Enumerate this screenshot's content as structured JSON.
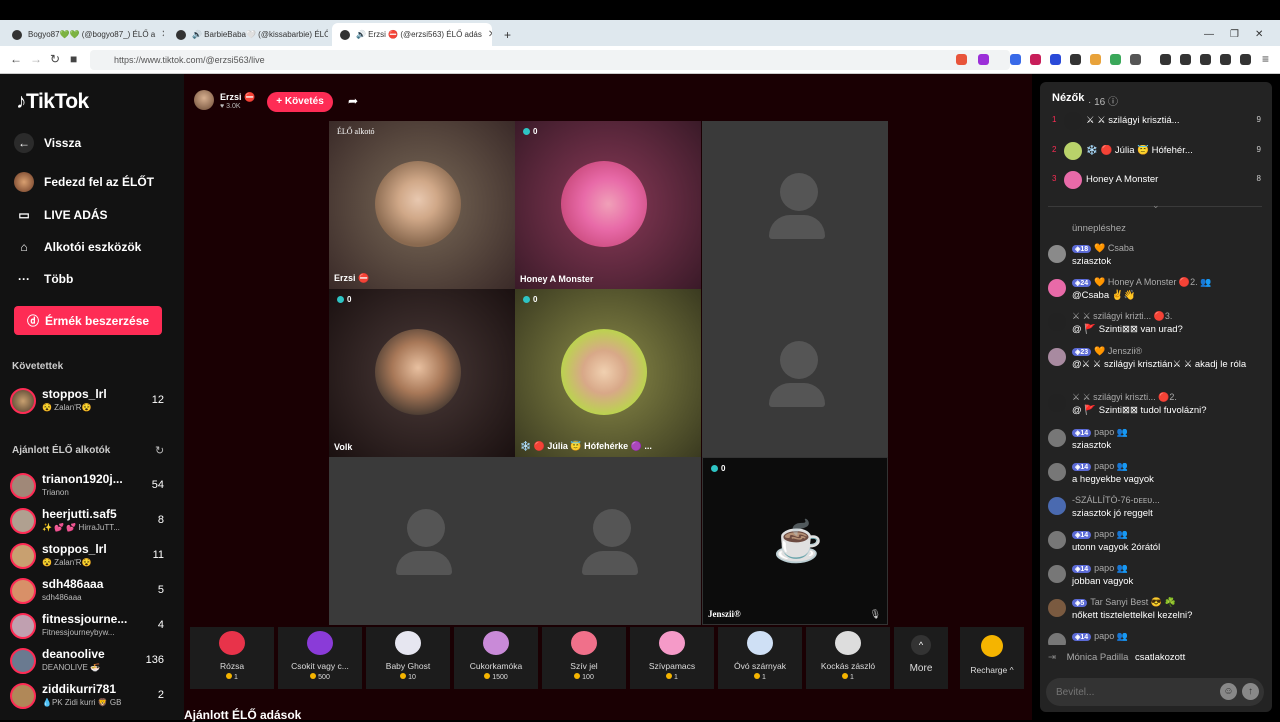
{
  "browser": {
    "tabs": [
      {
        "title": "Bogyo87💚💚 (@bogyo87_) ÉLŐ a"
      },
      {
        "title": "🔊 BarbieBaba🤍 (@kissabarbie) ÉLŐ"
      },
      {
        "title": "🔊 Erzsi ⛔ (@erzsi563) ÉLŐ adás"
      }
    ],
    "new_tab": "+",
    "url": "https://www.tiktok.com/@erzsi563/live"
  },
  "sidebar": {
    "logo": "TikTok",
    "back": "Vissza",
    "nav": [
      {
        "label": "Fedezd fel az ÉLŐT",
        "icon": "explore-icon"
      },
      {
        "label": "LIVE ADÁS",
        "icon": "camera-icon"
      },
      {
        "label": "Alkotói eszközök",
        "icon": "tools-icon"
      },
      {
        "label": "Több",
        "icon": "more-icon"
      }
    ],
    "coins_button": "Érmék beszerzése",
    "following_title": "Követettek",
    "following": [
      {
        "name": "stoppos_lrl",
        "sub": "😵 Zalan'R😵",
        "count": "12"
      }
    ],
    "recommended_title": "Ajánlott ÉLŐ alkotók",
    "recommended": [
      {
        "name": "trianon1920j...",
        "sub": "Trianon",
        "count": "54"
      },
      {
        "name": "heerjutti.saf5",
        "sub": "✨ 💕 💕 HirraJuTT...",
        "count": "8"
      },
      {
        "name": "stoppos_lrl",
        "sub": "😵 Zalan'R😵",
        "count": "11"
      },
      {
        "name": "sdh486aaa",
        "sub": "sdh486aaa",
        "count": "5"
      },
      {
        "name": "fitnessjourne...",
        "sub": "Fitnessjourneybyw...",
        "count": "4"
      },
      {
        "name": "deanoolive",
        "sub": "DEANOLIVE 🍜",
        "count": "136"
      },
      {
        "name": "ziddikurri781",
        "sub": "💧PK Zidi kurri 🦁 GB",
        "count": "2"
      }
    ]
  },
  "stream": {
    "host_name": "Erzsi ⛔",
    "host_likes": "♥ 3.0K",
    "follow": "+ Követés",
    "cells": [
      {
        "label": "Erzsi ⛔",
        "tag": "ÉLŐ alkotó"
      },
      {
        "label": "Honey A Monster",
        "count": "0"
      },
      {
        "label": "",
        "count": ""
      },
      {
        "label": "Volk",
        "count": "0"
      },
      {
        "label": "❄️ 🔴 Júlia 😇 Hófehérke 🟣 ...",
        "count": "0"
      },
      {
        "label": "",
        "count": ""
      },
      {
        "label": "",
        "count": ""
      },
      {
        "label": "",
        "count": ""
      },
      {
        "label": "Jenszii®",
        "count": "0"
      }
    ],
    "gifts": [
      {
        "name": "Rózsa",
        "price": "1",
        "color": "#e8334a"
      },
      {
        "name": "Csokit vagy c...",
        "price": "500",
        "color": "#8a3bd8"
      },
      {
        "name": "Baby Ghost",
        "price": "10",
        "color": "#e6e6f0"
      },
      {
        "name": "Cukorkamóka",
        "price": "1500",
        "color": "#c98ad8"
      },
      {
        "name": "Szív jel",
        "price": "100",
        "color": "#f0708a"
      },
      {
        "name": "Szívpamacs",
        "price": "1",
        "color": "#f59ac8"
      },
      {
        "name": "Óvó szárnyak",
        "price": "1",
        "color": "#cfe0f5"
      },
      {
        "name": "Kockás zászló",
        "price": "1",
        "color": "#ddd"
      }
    ],
    "more": "More",
    "recharge": "Recharge ^",
    "recommended_title": "Ajánlott ÉLŐ adások"
  },
  "panel": {
    "viewers_title": "Nézők",
    "viewers_count": "· 16 ⓘ",
    "viewers": [
      {
        "rank": "1",
        "name": "⚔ ⚔ szilágyi krisztiá...",
        "score": "9",
        "color": "#222"
      },
      {
        "rank": "2",
        "name": "❄️ 🔴 Júlia 😇 Hófehér...",
        "score": "9",
        "color": "#b9d26a"
      },
      {
        "rank": "3",
        "name": "Honey A Monster",
        "score": "8",
        "color": "#e86aa8"
      }
    ],
    "chat": [
      {
        "level": "",
        "user": "",
        "text": "ünnepléshez",
        "color": "#333"
      },
      {
        "level": "◈18",
        "user": "🧡 Csaba",
        "text": "sziasztok",
        "color": "#8a8a8a"
      },
      {
        "level": "◈24",
        "user": "🧡 Honey A Monster 🔴2. 👥",
        "text": "@Csaba ✌👋",
        "color": "#e86aa8"
      },
      {
        "level": "",
        "user": "⚔ ⚔ szilágyi krizti... 🔴3.",
        "text": "@ 🚩 Szinti⊠⊠ van urad?",
        "color": "#222"
      },
      {
        "level": "◈23",
        "user": "🧡 Jenszii®",
        "text": "@⚔ ⚔ szilágyi krisztián⚔ ⚔ akadj le róla",
        "color": "#a88aa0"
      },
      {
        "level": "",
        "user": "⚔ ⚔ szilágyi kriszti... 🔴2.",
        "text": "@ 🚩 Szinti⊠⊠ tudol fuvolázni?",
        "color": "#222"
      },
      {
        "level": "◈14",
        "user": "papo 👥",
        "text": "sziasztok",
        "color": "#777"
      },
      {
        "level": "◈14",
        "user": "papo 👥",
        "text": "a hegyekbe vagyok",
        "color": "#777"
      },
      {
        "level": "",
        "user": "-SZÁLLÍTÓ-76-ᴅᴇᴇᴜ...",
        "text": "sziasztok jó reggelt",
        "color": "#4a6ab0"
      },
      {
        "level": "◈14",
        "user": "papo 👥",
        "text": "utonn vagyok 2órától",
        "color": "#777"
      },
      {
        "level": "◈14",
        "user": "papo 👥",
        "text": "jobban vagyok",
        "color": "#777"
      },
      {
        "level": "◈5",
        "user": "Tar Sanyi Best 😎 ☘️",
        "text": "nőkett tisztelettelkel kezelni?",
        "color": "#7a5a40"
      },
      {
        "level": "◈14",
        "user": "papo 👥",
        "text": "",
        "color": "#777"
      }
    ],
    "join_name": "Mónica Padilla",
    "join_text": "csatlakozott",
    "input_placeholder": "Bevitel..."
  }
}
